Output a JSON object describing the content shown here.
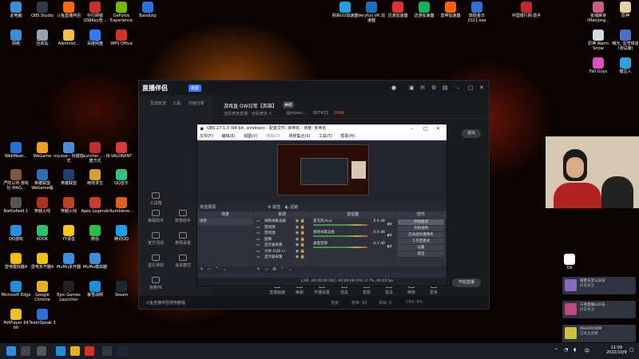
{
  "desktop": {
    "left_icons": [
      {
        "label": "此电脑",
        "color": "#3b8fd6"
      },
      {
        "label": "OBS Studio",
        "color": "#333a45"
      },
      {
        "label": "斗鱼直播伴侣",
        "color": "#ff6a00"
      },
      {
        "label": "中行网银 USBKey管...",
        "color": "#c9302c"
      },
      {
        "label": "GeForce Experience",
        "color": "#76b900"
      },
      {
        "label": "Bandizip",
        "color": "#2a6fdb"
      },
      {
        "label": "网络",
        "color": "#3b8fd6"
      },
      {
        "label": "回收站",
        "color": "#9aa4b0"
      },
      {
        "label": "Administ...",
        "color": "#f0c040"
      },
      {
        "label": "百度网盘",
        "color": "#2d7cff"
      },
      {
        "label": "WPS Office",
        "color": "#d93025"
      },
      {
        "label": "WebMeet...",
        "color": "#2a6fdb"
      },
      {
        "label": "WeGame",
        "color": "#f0a020"
      },
      {
        "label": "my.exe - 快捷方式",
        "color": "#4a90d9"
      },
      {
        "label": "Launcher... - 快捷方式",
        "color": "#c03030"
      },
      {
        "label": "VALORANT",
        "color": "#d63a3a"
      },
      {
        "label": "严阵以待 游戏社-MAO...",
        "color": "#7a5a3a"
      },
      {
        "label": "英雄联盟 WeGame版",
        "color": "#2f6fb5"
      },
      {
        "label": "英雄联盟",
        "color": "#1f3f6f"
      },
      {
        "label": "绝地求生",
        "color": "#d8a030"
      },
      {
        "label": "QQ音乐",
        "color": "#31c27c"
      },
      {
        "label": "Battlefield 1",
        "color": "#555"
      },
      {
        "label": "穿越火线",
        "color": "#b03020"
      },
      {
        "label": "穿越火线",
        "color": "#c04020"
      },
      {
        "label": "Apex Legends",
        "color": "#d03a2a"
      },
      {
        "label": "Rumbleve...",
        "color": "#e06020"
      },
      {
        "label": "QQ游戏",
        "color": "#2a8fe0"
      },
      {
        "label": "KOOK",
        "color": "#2bc36b"
      },
      {
        "label": "YY语音",
        "color": "#f5c518"
      },
      {
        "label": "微信",
        "color": "#2ac23b"
      },
      {
        "label": "腾讯QQ",
        "color": "#1aa0f0"
      },
      {
        "label": "雷电模拟器4",
        "color": "#f2c200"
      },
      {
        "label": "雷电多开器4",
        "color": "#f2c200"
      },
      {
        "label": "MuMu多开器",
        "color": "#3a8fe0"
      },
      {
        "label": "MuMu模拟器",
        "color": "#3a8fe0"
      },
      {
        "label": "Microsoft Edge",
        "color": "#1e90d8"
      },
      {
        "label": "Google Chrome",
        "color": "#e8b020"
      },
      {
        "label": "Epic Games Launcher",
        "color": "#222"
      },
      {
        "label": "暴雪战网",
        "color": "#1a8fe0"
      },
      {
        "label": "Steam",
        "color": "#1b2838"
      },
      {
        "label": "PotPlayer 64 bit",
        "color": "#f0c020"
      },
      {
        "label": "TeamSpeak 3",
        "color": "#2a6fdb"
      }
    ],
    "top_right_icons": [
      {
        "label": "网易UU加速器",
        "color": "#20a0e0"
      },
      {
        "label": "Veryfun VK 加速器",
        "color": "#1a6fc0"
      },
      {
        "label": "迅游加速器",
        "color": "#e03030"
      },
      {
        "label": "迅游加速器",
        "color": "#10b060"
      },
      {
        "label": "雷神加速器",
        "color": "#ff6000"
      },
      {
        "label": "鼓励金日 2021.exe",
        "color": "#3070d0"
      },
      {
        "label": "中国银行网 助手",
        "color": "#c0262e"
      },
      {
        "label": "雀魂麻将 (Mahjong...",
        "color": "#d05a8a"
      },
      {
        "label": "原神",
        "color": "#e8d0a0"
      },
      {
        "label": "原神 Warm Snow",
        "color": "#d0d8e0"
      },
      {
        "label": "曙光, 星穹铁道 (测试服)",
        "color": "#4a6fd0"
      },
      {
        "label": "Fall Guys",
        "color": "#e050c0"
      },
      {
        "label": "糖豆人",
        "color": "#30a0e0"
      }
    ]
  },
  "helper": {
    "logo": "直播伴侣",
    "badge": "新版",
    "tabs": [
      "互动玩法",
      "工具",
      "内容分析"
    ],
    "room_title": "游戏直 OW日常【英雄】",
    "room_tag": "美颜",
    "room_sub": "全民竞技直播 · 全民竞技 ✎",
    "stats": [
      "@jmpan...",
      "687433",
      "1649"
    ],
    "side_buttons": [
      "工具箱",
      "弹幕助手",
      "房管助手",
      "官方活动",
      "表情设置",
      "送礼特效",
      "道具模式",
      "连麦PK"
    ],
    "bottom_tools": [
      "直播画面",
      "美颜",
      "开播设置",
      "道具",
      "音效",
      "道具",
      "特效",
      "更多"
    ],
    "footer_text": "斗鱼直播伴侣使用教程",
    "exit_label": "退出",
    "start_label": "开始直播",
    "status_values": [
      "连接",
      "帧率: 60",
      "丢帧: 0",
      "CPU: 8%"
    ]
  },
  "obs": {
    "title": "OBS 27.1.3 (64-bit, windows) - 配置文件: 未命名 - 场景: 未命名",
    "menus": [
      "文件(F)",
      "编辑(E)",
      "视图(V)",
      "停靠(D)",
      "场景集合(S)",
      "工具(T)",
      "帮助(H)"
    ],
    "scene_toolbar": "未选择源",
    "toolbar_buttons": [
      "属性",
      "滤镜"
    ],
    "panels": [
      "场景",
      "来源",
      "混音器",
      "转场特效",
      "控件"
    ],
    "scenes": [
      "场景"
    ],
    "sources": [
      {
        "name": "视频采集设备"
      },
      {
        "name": "游戏源"
      },
      {
        "name": "游戏源"
      },
      {
        "name": "图像"
      },
      {
        "name": "显示器采集"
      },
      {
        "name": "文本 (GDI+)"
      },
      {
        "name": "显示器采集"
      }
    ],
    "mixer": [
      {
        "name": "麦克风/Aux",
        "value": "0.0 dB"
      },
      {
        "name": "视频采集设备",
        "value": "0.0 dB"
      },
      {
        "name": "桌面音频",
        "value": "-4.1 dB"
      }
    ],
    "controls": [
      "开始推流",
      "开始录制",
      "启动虚拟摄像机",
      "工作室模式",
      "设置",
      "退出"
    ],
    "status": "LIVE: 00:00:00   REC: 00:00:00   CPU: 0.7%, 60.00 fps"
  },
  "notifications": [
    {
      "title": "极客天堂公众号",
      "sub": "好友关注",
      "color": "#8a6ac0"
    },
    {
      "title": "三哥直播公众号",
      "sub": "好友关注",
      "color": "#c04a7a"
    },
    {
      "title": "MSHAROOM",
      "sub": "已关注直播",
      "color": "#d0c040"
    }
  ],
  "ea_label": "EA",
  "taskbar": {
    "time": "11:09",
    "date": "2022/10/9",
    "lang": "中",
    "apps": [
      {
        "name": "start",
        "color": "#2a8fe0"
      },
      {
        "name": "search",
        "color": "#444"
      },
      {
        "name": "task-view",
        "color": "#555"
      },
      {
        "name": "edge",
        "color": "#1e90d8"
      },
      {
        "name": "explorer",
        "color": "#e8b020"
      },
      {
        "name": "wps",
        "color": "#d93025"
      },
      {
        "name": "obs",
        "color": "#333a45"
      },
      {
        "name": "steam",
        "color": "#1b2838"
      }
    ]
  }
}
